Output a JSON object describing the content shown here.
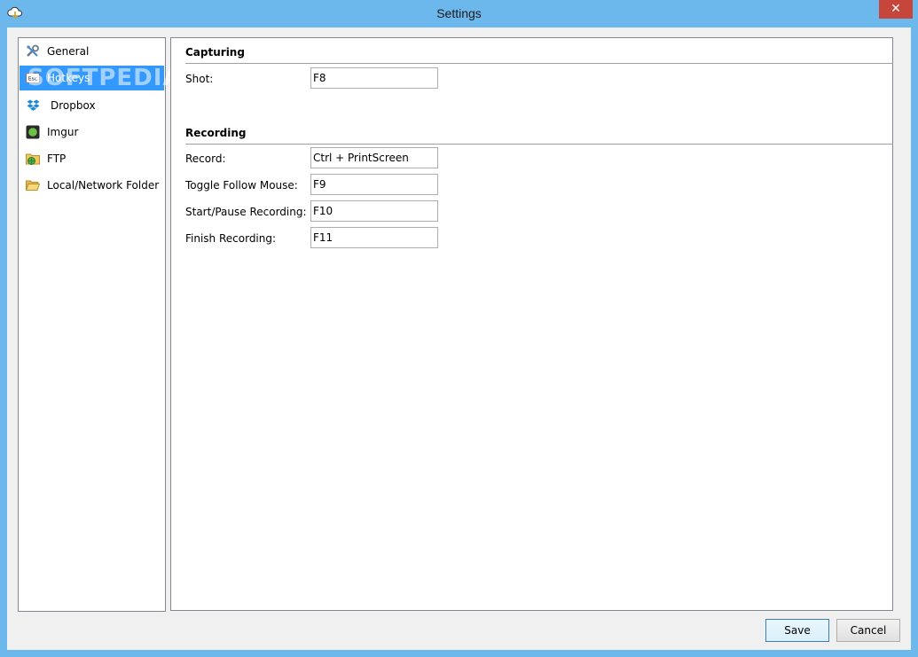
{
  "window": {
    "title": "Settings",
    "close_glyph": "✕",
    "icon": "cloud-upload-icon"
  },
  "sidebar": {
    "items": [
      {
        "label": "General",
        "icon": "tools-icon",
        "selected": false
      },
      {
        "label": "Hotkeys",
        "icon": "esc-key-icon",
        "selected": true
      },
      {
        "label": "Dropbox",
        "icon": "dropbox-icon",
        "selected": false
      },
      {
        "label": "Imgur",
        "icon": "imgur-icon",
        "selected": false
      },
      {
        "label": "FTP",
        "icon": "ftp-folder-globe-icon",
        "selected": false
      },
      {
        "label": "Local/Network Folder",
        "icon": "open-folder-icon",
        "selected": false
      }
    ]
  },
  "capturing": {
    "title": "Capturing",
    "shot_label": "Shot:",
    "shot_value": "F8"
  },
  "recording": {
    "title": "Recording",
    "record_label": "Record:",
    "record_value": "Ctrl + PrintScreen",
    "follow_label": "Toggle Follow Mouse:",
    "follow_value": "F9",
    "pause_label": "Start/Pause Recording:",
    "pause_value": "F10",
    "finish_label": "Finish Recording:",
    "finish_value": "F11"
  },
  "buttons": {
    "save": "Save",
    "cancel": "Cancel"
  },
  "watermark": "SOFTPEDIA",
  "colors": {
    "titlebar": "#6cb8ec",
    "selection": "#3399ff",
    "close": "#c7463b"
  }
}
